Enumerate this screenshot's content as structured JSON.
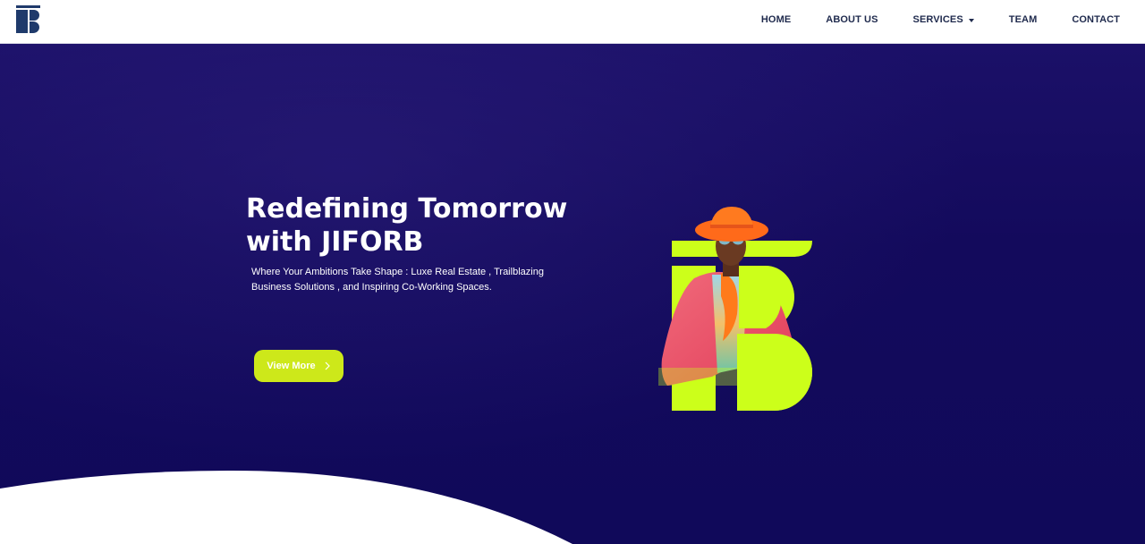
{
  "brand": {
    "logo_icon": "jiforb-logo-icon",
    "logo_color": "#1f3a6b"
  },
  "nav": {
    "items": [
      {
        "label": "HOME"
      },
      {
        "label": "ABOUT US"
      },
      {
        "label": "SERVICES",
        "has_dropdown": true
      },
      {
        "label": "TEAM"
      },
      {
        "label": "CONTACT"
      }
    ],
    "text_color": "#1f2a4d"
  },
  "hero": {
    "title_line1": "Redefining Tomorrow",
    "title_line2": "with JIFORB",
    "subtitle": "Where Your Ambitions Take Shape : Luxe Real Estate , Trailblazing Business Solutions , and Inspiring Co-Working Spaces.",
    "cta_label": "View More",
    "cta_icon": "chevron-right-icon",
    "background_color": "#130a5c",
    "accent_color": "#cde81a"
  }
}
